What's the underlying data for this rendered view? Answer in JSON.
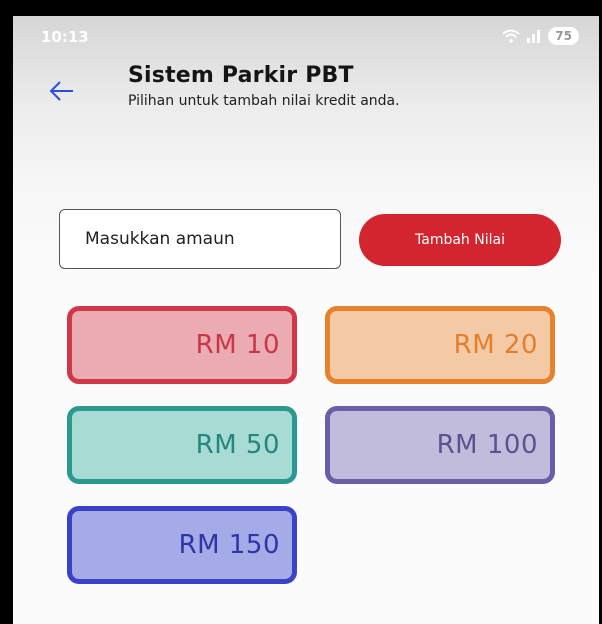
{
  "status_bar": {
    "time": "10:13",
    "battery": "75"
  },
  "header": {
    "title": "Sistem Parkir PBT",
    "subtitle": "Pilihan untuk tambah nilai kredit anda."
  },
  "form": {
    "amount_placeholder": "Masukkan amaun",
    "topup_label": "Tambah Nilai",
    "topup_color": "#d3252f"
  },
  "amount_options": [
    {
      "label": "RM 10",
      "border": "#d0384a",
      "fill": "#ebabb3",
      "text": "#c93747"
    },
    {
      "label": "RM 20",
      "border": "#e8812c",
      "fill": "#f3c9a6",
      "text": "#e4802c"
    },
    {
      "label": "RM 50",
      "border": "#2a9a8e",
      "fill": "#a7dbd4",
      "text": "#22887e"
    },
    {
      "label": "RM 100",
      "border": "#6a5ea6",
      "fill": "#c2bcdc",
      "text": "#5b5390"
    },
    {
      "label": "RM 150",
      "border": "#3a42c8",
      "fill": "#a5abe6",
      "text": "#2f35a8"
    }
  ]
}
